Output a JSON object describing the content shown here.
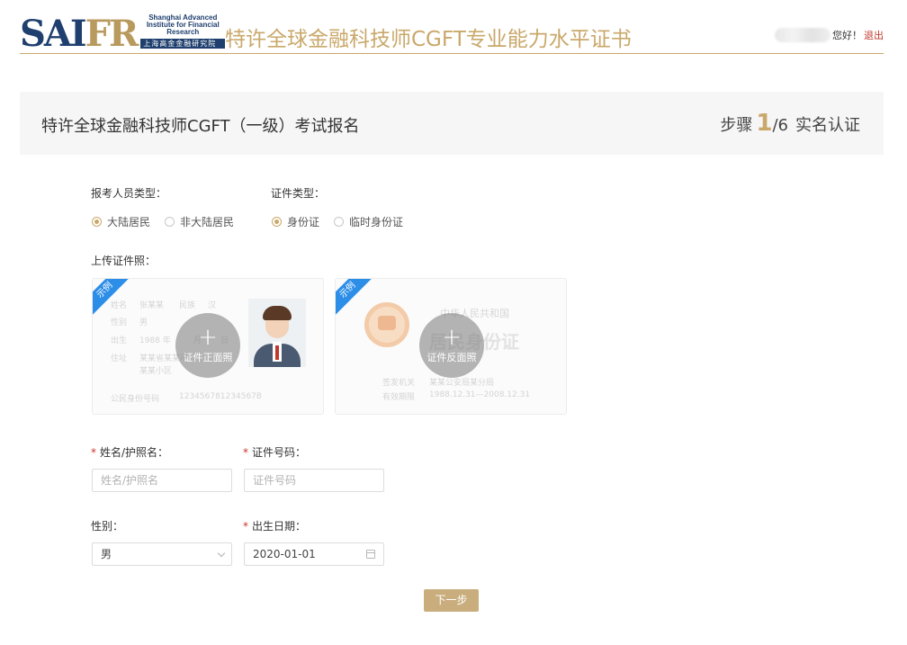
{
  "header": {
    "logo_mark_a": "SAI",
    "logo_mark_b": "FR",
    "logo_en": "Shanghai Advanced Institute for Financial Research",
    "logo_cn": "上海高金金融研究院",
    "site_title": "特许全球金融科技师CGFT专业能力水平证书",
    "greeting": "您好！",
    "logout": "退出"
  },
  "page": {
    "title": "特许全球金融科技师CGFT（一级）考试报名",
    "step_prefix": "步骤",
    "step_current": "1",
    "step_total": "/6",
    "step_name": "实名认证"
  },
  "form": {
    "applicant_type": {
      "label": "报考人员类型：",
      "options": [
        "大陆居民",
        "非大陆居民"
      ],
      "selected": "大陆居民"
    },
    "id_type": {
      "label": "证件类型：",
      "options": [
        "身份证",
        "临时身份证"
      ],
      "selected": "身份证"
    },
    "upload": {
      "label": "上传证件照：",
      "sample_tag": "示例",
      "front": {
        "caption": "证件正面照",
        "ghost_lines": [
          "姓名",
          "张某某",
          "民族",
          "汉",
          "性别",
          "男",
          "出生",
          "1988 年",
          "月",
          "日",
          "住址",
          "某某省某某市",
          "某某小区",
          "公民身份号码",
          "123456781234567B"
        ]
      },
      "back": {
        "caption": "证件反面照",
        "ghost_country": "中华人民共和国",
        "ghost_title": "居民身份证",
        "ghost_authority_label": "签发机关",
        "ghost_authority": "某某公安局某分局",
        "ghost_valid_label": "有效期限",
        "ghost_valid": "1988.12.31—2008.12.31"
      }
    },
    "name": {
      "label": "姓名/护照名：",
      "placeholder": "姓名/护照名",
      "value": ""
    },
    "id_number": {
      "label": "证件号码：",
      "placeholder": "证件号码",
      "value": ""
    },
    "gender": {
      "label": "性别：",
      "value": "男"
    },
    "birthdate": {
      "label": "出生日期：",
      "value": "2020-01-01"
    },
    "next_button": "下一步"
  },
  "colors": {
    "accent_gold": "#c9a86a",
    "button_gold": "#c9ad7d",
    "logo_navy": "#1f3f6e",
    "required_red": "#d0332d",
    "ribbon_blue": "#2d8ee8"
  },
  "icons": [
    "plus-icon",
    "calendar-icon",
    "chevron-down-icon",
    "radio-icon"
  ]
}
